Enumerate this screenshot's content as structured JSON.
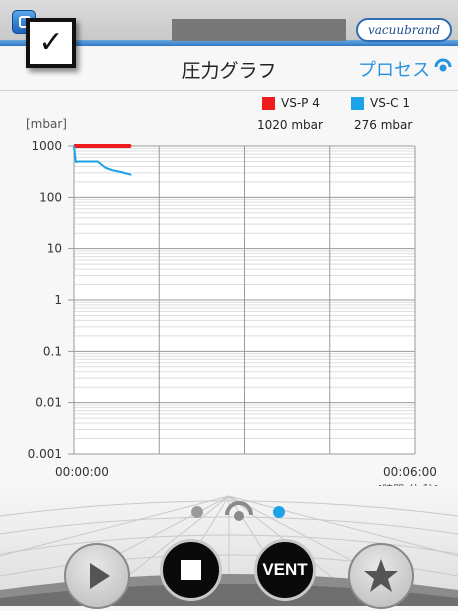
{
  "brand": "vacuubrand",
  "header": {
    "title": "圧力グラフ",
    "process_link": "プロセス"
  },
  "legend": [
    {
      "label": "VS-P 4",
      "value": "1020 mbar",
      "color": "#ee1c1c"
    },
    {
      "label": "VS-C 1",
      "value": "276 mbar",
      "color": "#1aa3e8"
    }
  ],
  "chart_data": {
    "type": "line",
    "y_scale": "log",
    "ylabel": "[mbar]",
    "ylim": [
      0.001,
      1000
    ],
    "ytick_labels": [
      "1000",
      "100",
      "10",
      "1",
      "0.1",
      "0.01",
      "0.001"
    ],
    "xlim": [
      "00:00:00",
      "00:06:00"
    ],
    "x_start_label": "00:00:00",
    "x_end_label": "00:06:00",
    "x_unit_label": "[時間:分:秒]",
    "grid": true,
    "series": [
      {
        "name": "VS-P 4",
        "color": "#ee1c1c",
        "x": [
          "00:00:00",
          "00:00:10",
          "00:00:20",
          "00:00:30",
          "00:00:40",
          "00:00:50",
          "00:01:00"
        ],
        "y": [
          1000,
          1000,
          1000,
          1000,
          1000,
          1000,
          1000
        ]
      },
      {
        "name": "VS-C 1",
        "color": "#1aa3e8",
        "x": [
          "00:00:00",
          "00:00:02",
          "00:00:05",
          "00:00:25",
          "00:00:33",
          "00:00:40",
          "00:00:50",
          "00:01:00"
        ],
        "y": [
          1000,
          490,
          500,
          500,
          380,
          340,
          310,
          276
        ]
      }
    ]
  },
  "page_indicator": {
    "count": 3,
    "active": 2
  },
  "controls": {
    "vent_label": "VENT"
  },
  "colors": {
    "accent": "#2a93e0",
    "pressure_red": "#ee1c1c",
    "pressure_blue": "#1aa3e8"
  }
}
